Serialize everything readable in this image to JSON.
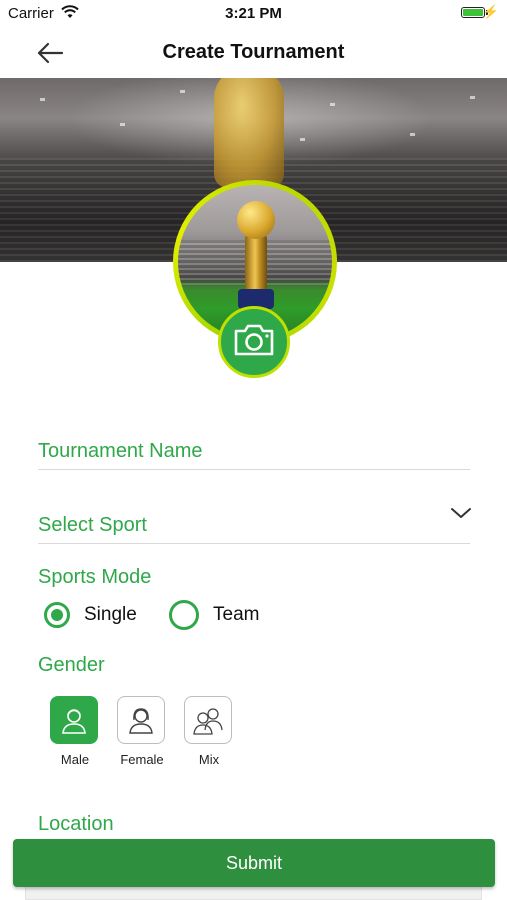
{
  "status_bar": {
    "carrier": "Carrier",
    "time": "3:21 PM"
  },
  "nav": {
    "title": "Create Tournament"
  },
  "form": {
    "tournament_name_placeholder": "Tournament Name",
    "select_sport_placeholder": "Select Sport",
    "sports_mode_label": "Sports Mode",
    "sports_mode_options": [
      {
        "label": "Single",
        "selected": true
      },
      {
        "label": "Team",
        "selected": false
      }
    ],
    "gender_label": "Gender",
    "gender_options": [
      {
        "label": "Male",
        "selected": true
      },
      {
        "label": "Female",
        "selected": false
      },
      {
        "label": "Mix",
        "selected": false
      }
    ],
    "location_label": "Location"
  },
  "submit_label": "Submit",
  "colors": {
    "accent": "#2fa84a",
    "submit": "#2e8f3f",
    "ring": "#c8e000"
  },
  "icons": [
    "wifi-icon",
    "battery-icon",
    "back-arrow-icon",
    "camera-icon",
    "chevron-down-icon",
    "male-icon",
    "female-icon",
    "mix-icon"
  ]
}
